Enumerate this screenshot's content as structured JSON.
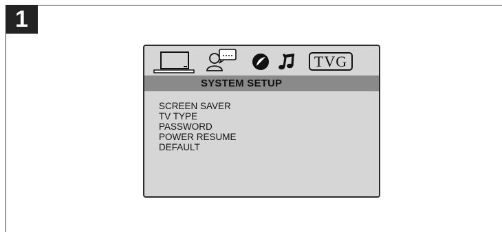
{
  "step": {
    "number": "1"
  },
  "osd": {
    "icons": [
      {
        "name": "system-setup-icon",
        "selected": true
      },
      {
        "name": "language-setup-icon",
        "selected": false
      },
      {
        "name": "video-setup-icon",
        "selected": false
      },
      {
        "name": "audio-setup-icon",
        "selected": false
      },
      {
        "name": "rating-setup-icon",
        "selected": false
      }
    ],
    "rating_label": "TVG",
    "header_title": "SYSTEM SETUP",
    "menu_items": [
      "SCREEN SAVER",
      "TV TYPE",
      "PASSWORD",
      "POWER RESUME",
      "DEFAULT"
    ]
  },
  "colors": {
    "panel_background": "#d6d6d6",
    "header_bar": "#8a8a8a",
    "badge_background": "#232323",
    "text": "#111111"
  }
}
